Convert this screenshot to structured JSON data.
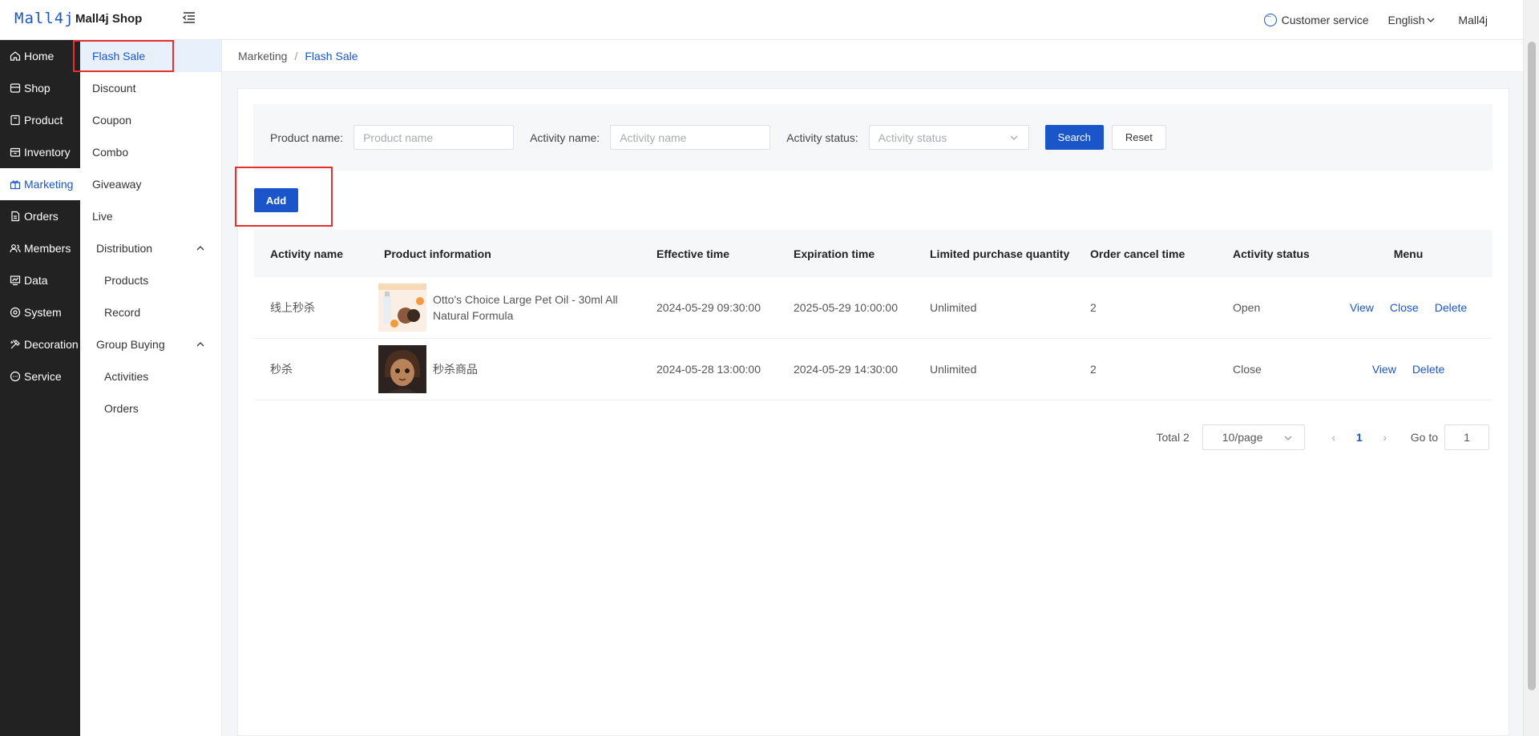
{
  "app": {
    "logo": "Mall4j",
    "shop_name": "Mall4j Shop"
  },
  "header": {
    "customer_service": "Customer service",
    "language": "English",
    "user": "Mall4j"
  },
  "primary_nav": [
    {
      "label": "Home",
      "icon": "home-icon"
    },
    {
      "label": "Shop",
      "icon": "shop-icon"
    },
    {
      "label": "Product",
      "icon": "product-icon"
    },
    {
      "label": "Inventory",
      "icon": "inventory-icon"
    },
    {
      "label": "Marketing",
      "icon": "gift-icon",
      "active": true
    },
    {
      "label": "Orders",
      "icon": "orders-icon"
    },
    {
      "label": "Members",
      "icon": "members-icon"
    },
    {
      "label": "Data",
      "icon": "data-icon"
    },
    {
      "label": "System",
      "icon": "system-icon"
    },
    {
      "label": "Decoration",
      "icon": "decoration-icon"
    },
    {
      "label": "Service",
      "icon": "service-icon"
    }
  ],
  "secondary_nav": {
    "items": [
      "Flash Sale",
      "Discount",
      "Coupon",
      "Combo",
      "Giveaway",
      "Live"
    ],
    "distribution": {
      "label": "Distribution",
      "children": [
        "Products",
        "Record"
      ]
    },
    "group_buying": {
      "label": "Group Buying",
      "children": [
        "Activities",
        "Orders"
      ]
    }
  },
  "breadcrumb": {
    "parent": "Marketing",
    "sep": "/",
    "current": "Flash Sale"
  },
  "search": {
    "product_label": "Product name:",
    "product_placeholder": "Product name",
    "activity_label": "Activity name:",
    "activity_placeholder": "Activity name",
    "status_label": "Activity status:",
    "status_placeholder": "Activity status",
    "search_btn": "Search",
    "reset_btn": "Reset"
  },
  "add_btn": "Add",
  "table": {
    "columns": [
      "Activity name",
      "Product information",
      "Effective time",
      "Expiration time",
      "Limited purchase quantity",
      "Order cancel time",
      "Activity status",
      "Menu"
    ],
    "rows": [
      {
        "activity_name": "线上秒杀",
        "product": "Otto's Choice Large Pet Oil - 30ml All Natural Formula",
        "effective": "2024-05-29 09:30:00",
        "expiration": "2025-05-29 10:00:00",
        "limit": "Unlimited",
        "cancel_time": "2",
        "status": "Open",
        "actions": [
          "View",
          "Close",
          "Delete"
        ]
      },
      {
        "activity_name": "秒杀",
        "product": "秒杀商品",
        "effective": "2024-05-28 13:00:00",
        "expiration": "2024-05-29 14:30:00",
        "limit": "Unlimited",
        "cancel_time": "2",
        "status": "Close",
        "actions": [
          "View",
          "Delete"
        ]
      }
    ]
  },
  "pagination": {
    "total": "Total 2",
    "page_size": "10/page",
    "current": "1",
    "goto": "Go to",
    "goto_value": "1",
    "prev": "‹",
    "next": "›"
  },
  "colors": {
    "brand": "#1a56c9",
    "sidebar_bg": "#222222",
    "highlight_box": "#e5302d"
  }
}
